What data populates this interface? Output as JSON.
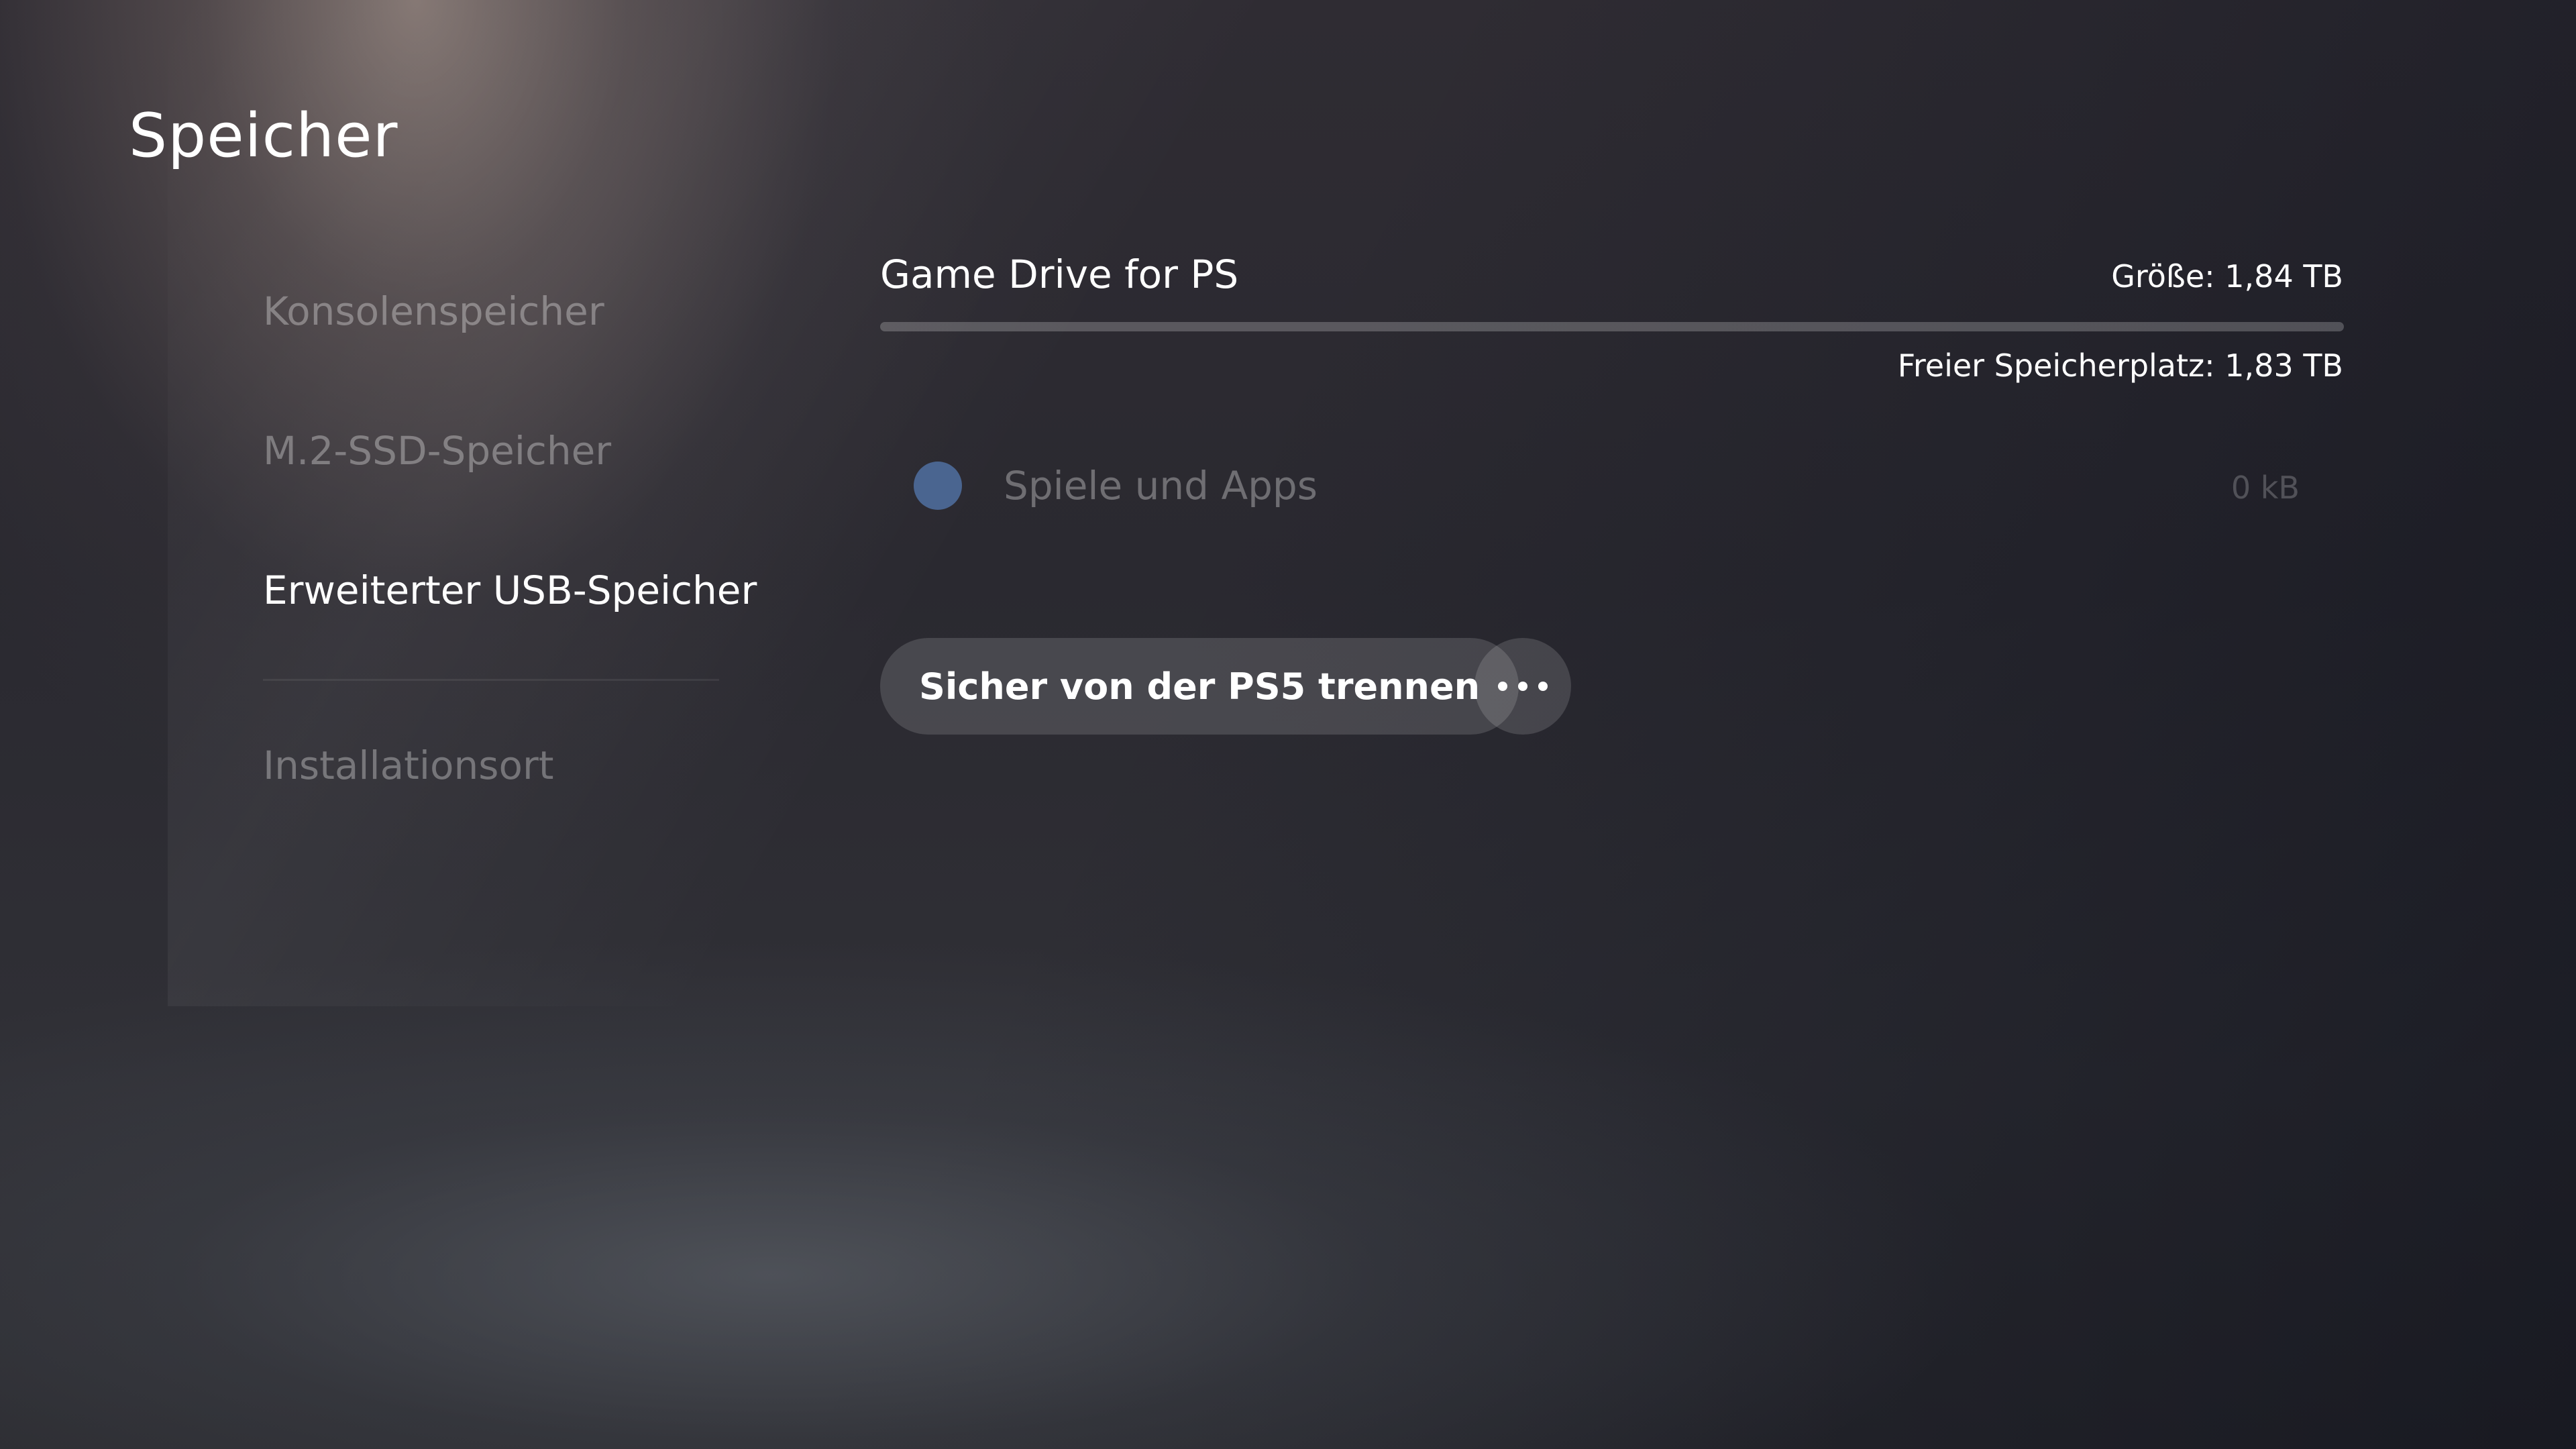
{
  "header": {
    "title": "Speicher"
  },
  "sidebar": {
    "items": [
      {
        "label": "Konsolenspeicher",
        "active": false
      },
      {
        "label": "M.2-SSD-Speicher",
        "active": false
      },
      {
        "label": "Erweiterter USB-Speicher",
        "active": true
      },
      {
        "label": "Installationsort",
        "active": false
      }
    ]
  },
  "device": {
    "name": "Game Drive for PS",
    "size_text": "Größe: 1,84 TB",
    "free_text": "Freier Speicherplatz: 1,83 TB",
    "used_fraction": 0.0
  },
  "categories": [
    {
      "label": "Spiele und Apps",
      "value": "0 kB",
      "color": "#4a6590"
    }
  ],
  "actions": {
    "disconnect_label": "Sicher von der PS5 trennen",
    "more_icon": "ellipsis-icon"
  },
  "colors": {
    "accent": "#3f74c9"
  }
}
